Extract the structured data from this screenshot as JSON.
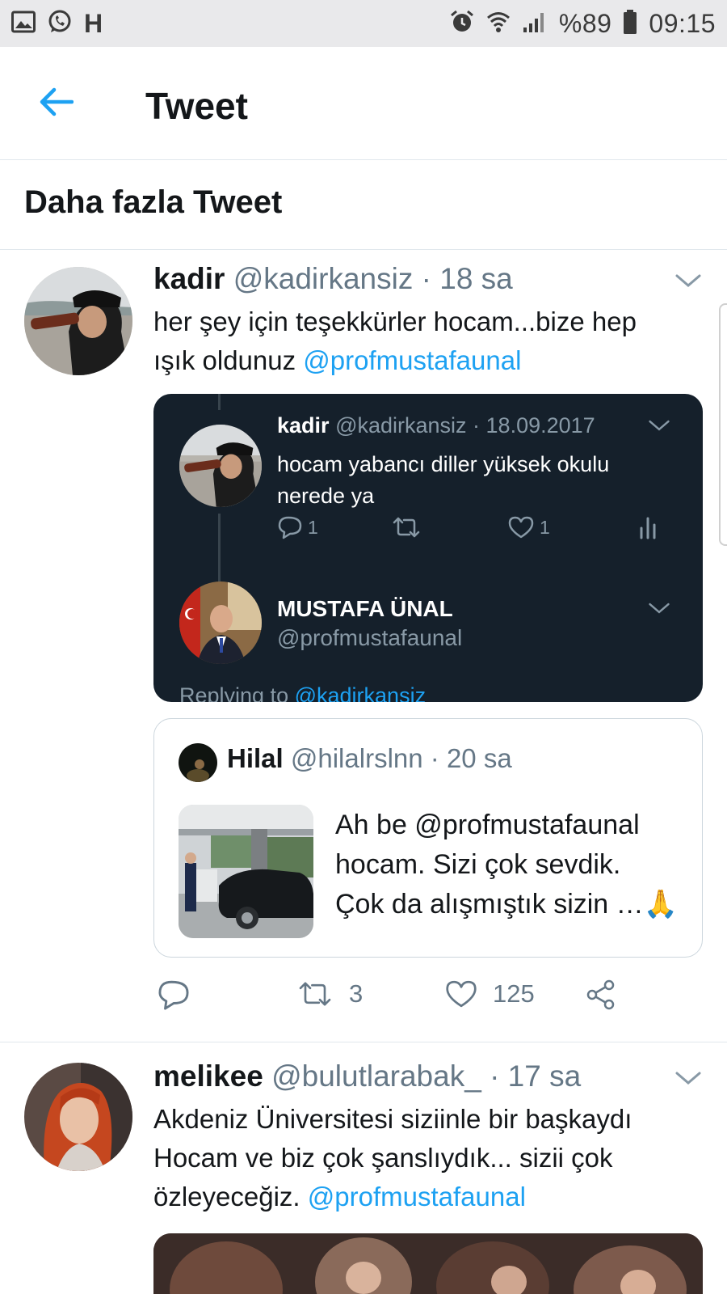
{
  "status_bar": {
    "left_icons": [
      "gallery-icon",
      "whatsapp-icon"
    ],
    "app_letter": "H",
    "right_icons": [
      "alarm-icon",
      "wifi-icon",
      "signal-icon",
      "battery-icon"
    ],
    "battery": "%89",
    "time": "09:15"
  },
  "header": {
    "back_icon": "back-arrow-icon",
    "title": "Tweet"
  },
  "section": {
    "title": "Daha fazla Tweet"
  },
  "tweets": [
    {
      "name": "kadir",
      "handle": "@kadirkansiz",
      "time": "· 18 sa",
      "text_line1": "her şey için teşekkürler hocam...bize hep",
      "text_line2": "ışık oldunuz",
      "mention": "@profmustafaunal",
      "embedded": {
        "parent": {
          "name": "kadir",
          "handle": "@kadirkansiz",
          "date": "· 18.09.2017",
          "text_line1": "hocam yabancı diller yüksek okulu",
          "text_line2": "nerede ya",
          "reply_count": "1",
          "like_count": "1"
        },
        "reply": {
          "name": "MUSTAFA ÜNAL",
          "handle": "@profmustafaunal",
          "replying_prefix": "Replying to",
          "replying_to": "@kadirkansiz"
        }
      },
      "quote": {
        "name": "Hilal",
        "handle": "@hilalrslnn",
        "time": "· 20 sa",
        "text_line1": "Ah be @profmustafaunal",
        "text_line2": "hocam. Sizi çok sevdik.",
        "text_line3": "Çok da alışmıştık sizin …🙏"
      },
      "actions": {
        "retweets": "3",
        "likes": "125"
      }
    },
    {
      "name": "melikee",
      "handle": "@bulutlarabak_",
      "time": "· 17 sa",
      "text_line1": "Akdeniz Üniversitesi siziinle bir başkaydı",
      "text_line2": "Hocam ve biz çok şanslıydık... sizii çok",
      "text_line3": "özleyeceğiz.",
      "mention": "@profmustafaunal"
    }
  ],
  "colors": {
    "accent": "#1da1f2",
    "dark_card": "#15202b",
    "muted": "#657786"
  }
}
